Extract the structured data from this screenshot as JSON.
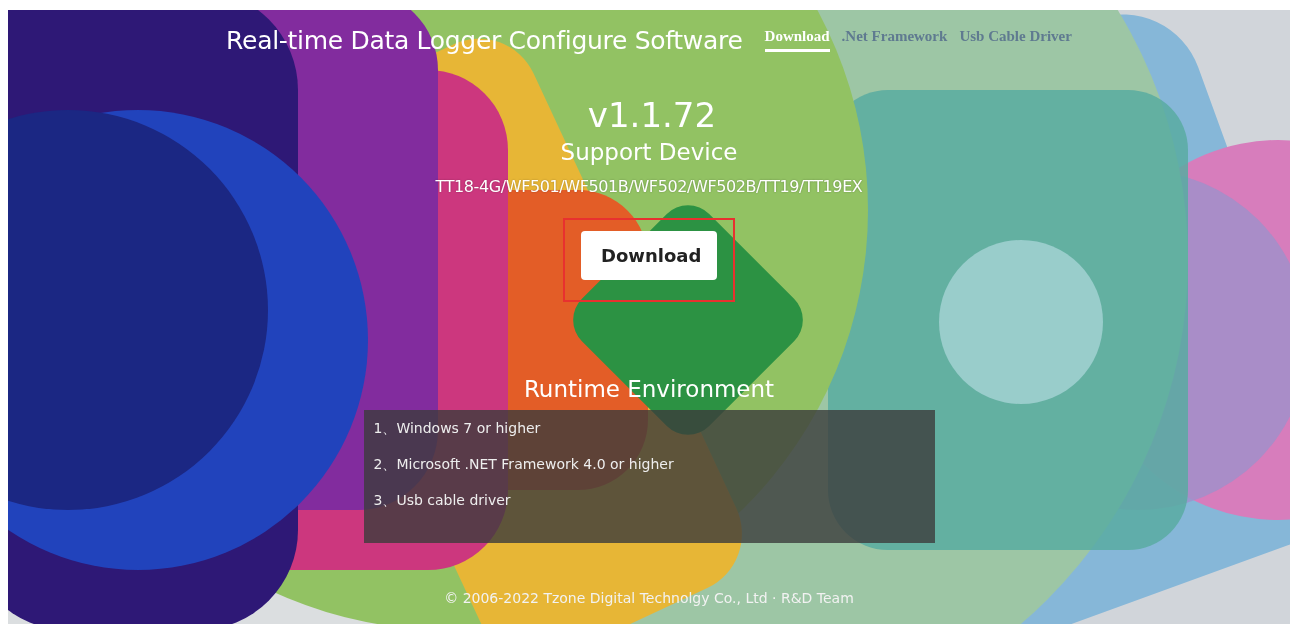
{
  "header": {
    "title": "Real-time Data Logger Configure Software"
  },
  "nav": [
    {
      "label": "Download",
      "selected": true
    },
    {
      "label": ".Net Framework",
      "selected": false
    },
    {
      "label": "Usb Cable Driver",
      "selected": false
    }
  ],
  "version": "v1.1.72",
  "support": {
    "heading": "Support Device",
    "devices": "TT18-4G/WF501/WF501B/WF502/WF502B/TT19/TT19EX"
  },
  "download_button": {
    "label": "Download",
    "highlighted": true
  },
  "runtime": {
    "heading": "Runtime Environment",
    "items": [
      "1、Windows 7 or higher",
      "2、Microsoft .NET Framework 4.0 or higher",
      "3、Usb cable driver"
    ]
  },
  "footer": "© 2006-2022 Tzone Digital Technolgy Co., Ltd · R&D Team"
}
